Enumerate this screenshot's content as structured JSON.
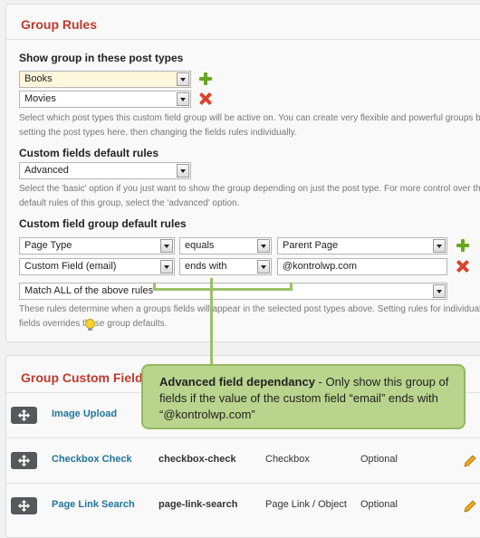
{
  "group_rules": {
    "title": "Group Rules",
    "post_types": {
      "label": "Show group in these post types",
      "selects": [
        "Books",
        "Movies"
      ],
      "description": "Select which post types this custom field group will be active on. You can create very flexible and powerful groups by setting the post types here, then changing the fields rules individually."
    },
    "default_rules": {
      "label": "Custom fields default rules",
      "value": "Advanced",
      "description": "Select the 'basic' option if you just want to show the group depending on just the post type. For more control over the default rules of this group, select the 'advanced' option."
    },
    "group_default_rules": {
      "label": "Custom field group default rules",
      "rules": [
        {
          "field": "Page Type",
          "operator": "equals",
          "value": "Parent Page"
        },
        {
          "field": "Custom Field (email)",
          "operator": "ends with",
          "value": "@kontrolwp.com"
        }
      ],
      "match": "Match ALL of the above rules",
      "description": "These rules determine when a groups fields will appear in the selected post types above. Setting rules for individual fields overrides these group defaults."
    }
  },
  "callout": {
    "bold": "Advanced field dependancy",
    "text": " - Only show this group of fields if the value of the custom field “email” ends with “@kontrolwp.com”"
  },
  "group_fields": {
    "title": "Group Custom Fields",
    "rows": [
      {
        "name": "Image Upload",
        "key": "",
        "type": "",
        "required": ""
      },
      {
        "name": "Checkbox Check",
        "key": "checkbox-check",
        "type": "Checkbox",
        "required": "Optional"
      },
      {
        "name": "Page Link Search",
        "key": "page-link-search",
        "type": "Page Link / Object",
        "required": "Optional"
      }
    ]
  },
  "colors": {
    "accent_title": "#c0392b",
    "link": "#21759b",
    "add": "#6aa61c",
    "remove": "#d94431",
    "callout": "#b9d48c"
  },
  "icons": [
    "plus-icon",
    "remove-icon",
    "chevron-down-icon",
    "lightbulb-icon",
    "move-icon",
    "pencil-icon"
  ]
}
